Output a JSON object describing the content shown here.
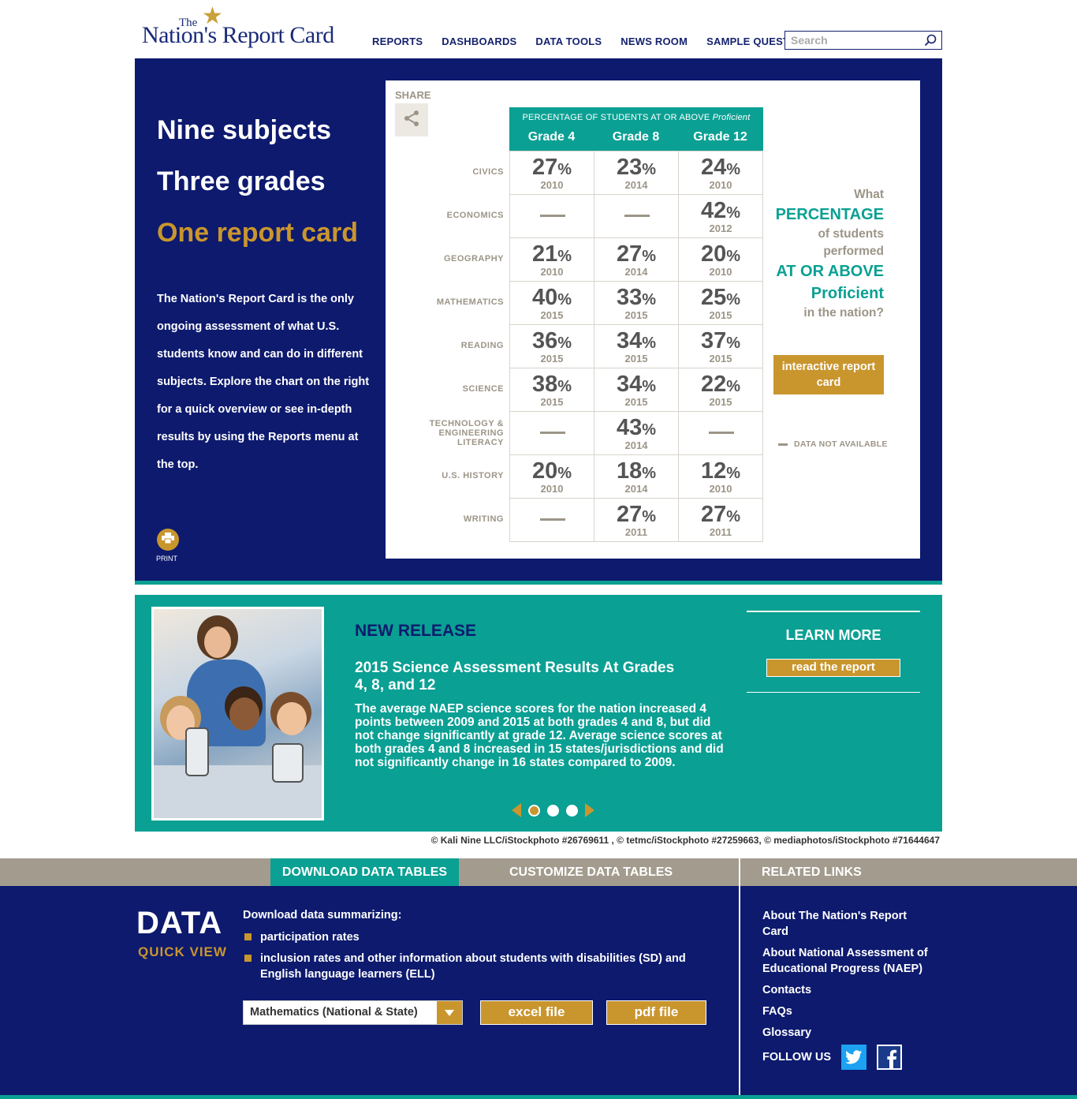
{
  "header": {
    "logo_the": "The",
    "logo_name": "Nation's Report Card",
    "nav": [
      "REPORTS",
      "DASHBOARDS",
      "DATA TOOLS",
      "NEWS ROOM",
      "SAMPLE QUESTIONS"
    ],
    "search_placeholder": "Search"
  },
  "hero": {
    "line1": "Nine subjects",
    "line2": "Three grades",
    "line3": "One report card",
    "description": "The Nation's Report Card is the only ongoing assessment of what U.S. students know and can do in different subjects. Explore the chart on the right for a quick overview or see in-depth results by using the Reports menu at the top.",
    "print_label": "PRINT"
  },
  "panel": {
    "share_label": "SHARE",
    "table_caption": "PERCENTAGE OF STUDENTS AT OR ABOVE",
    "table_caption_italic": "Proficient",
    "grades": [
      "Grade 4",
      "Grade 8",
      "Grade 12"
    ],
    "pct_sign": "%",
    "rows": [
      {
        "subject": "CIVICS",
        "cells": [
          {
            "v": "27",
            "y": "2010"
          },
          {
            "v": "23",
            "y": "2014"
          },
          {
            "v": "24",
            "y": "2010"
          }
        ]
      },
      {
        "subject": "ECONOMICS",
        "cells": [
          null,
          null,
          {
            "v": "42",
            "y": "2012"
          }
        ]
      },
      {
        "subject": "GEOGRAPHY",
        "cells": [
          {
            "v": "21",
            "y": "2010"
          },
          {
            "v": "27",
            "y": "2014"
          },
          {
            "v": "20",
            "y": "2010"
          }
        ]
      },
      {
        "subject": "MATHEMATICS",
        "cells": [
          {
            "v": "40",
            "y": "2015"
          },
          {
            "v": "33",
            "y": "2015"
          },
          {
            "v": "25",
            "y": "2015"
          }
        ]
      },
      {
        "subject": "READING",
        "cells": [
          {
            "v": "36",
            "y": "2015"
          },
          {
            "v": "34",
            "y": "2015"
          },
          {
            "v": "37",
            "y": "2015"
          }
        ]
      },
      {
        "subject": "SCIENCE",
        "cells": [
          {
            "v": "38",
            "y": "2015"
          },
          {
            "v": "34",
            "y": "2015"
          },
          {
            "v": "22",
            "y": "2015"
          }
        ]
      },
      {
        "subject": "TECHNOLOGY & ENGINEERING LITERACY",
        "subject_lines": [
          "TECHNOLOGY &",
          "ENGINEERING",
          "LITERACY"
        ],
        "cells": [
          null,
          {
            "v": "43",
            "y": "2014"
          },
          null
        ]
      },
      {
        "subject": "U.S. HISTORY",
        "cells": [
          {
            "v": "20",
            "y": "2010"
          },
          {
            "v": "18",
            "y": "2014"
          },
          {
            "v": "12",
            "y": "2010"
          }
        ]
      },
      {
        "subject": "WRITING",
        "cells": [
          null,
          {
            "v": "27",
            "y": "2011"
          },
          {
            "v": "27",
            "y": "2011"
          }
        ]
      }
    ],
    "side_q": {
      "l1": "What",
      "l2": "PERCENTAGE",
      "l3": "of students",
      "l4": "performed",
      "l5": "AT OR ABOVE",
      "l6": "Proficient",
      "l7": "in the nation?"
    },
    "interactive_btn": "interactive report card",
    "legend": "DATA NOT AVAILABLE"
  },
  "release": {
    "kicker": "NEW RELEASE",
    "title": "2015 Science Assessment Results At Grades 4, 8, and 12",
    "body": "The average NAEP science scores for the nation increased 4 points between 2009 and 2015 at both grades 4 and 8, but did not change significantly at grade 12. Average science scores at both grades 4 and 8 increased in 15 states/jurisdictions and did not significantly change in 16 states compared to 2009.",
    "learn_more": "LEARN MORE",
    "read_btn": "read the report",
    "credit": "© Kali Nine LLC/iStockphoto #26769611 , © tetmc/iStockphoto #27259663, © mediaphotos/iStockphoto #71644647"
  },
  "data_section": {
    "tab_download": "DOWNLOAD DATA TABLES",
    "tab_customize": "CUSTOMIZE DATA TABLES",
    "tab_related": "RELATED LINKS",
    "dq_data": "DATA",
    "dq_quick": "QUICK VIEW",
    "intro": "Download data summarizing:",
    "items": [
      "participation rates",
      "inclusion rates and other information about students with disabilities (SD) and English language learners (ELL)"
    ],
    "select_value": "Mathematics (National & State)",
    "excel_btn": "excel file",
    "pdf_btn": "pdf file",
    "related_links": [
      "About The Nation's Report Card",
      "About National Assessment of Educational Progress (NAEP)",
      "Contacts",
      "FAQs",
      "Glossary"
    ],
    "follow_label": "FOLLOW US"
  }
}
